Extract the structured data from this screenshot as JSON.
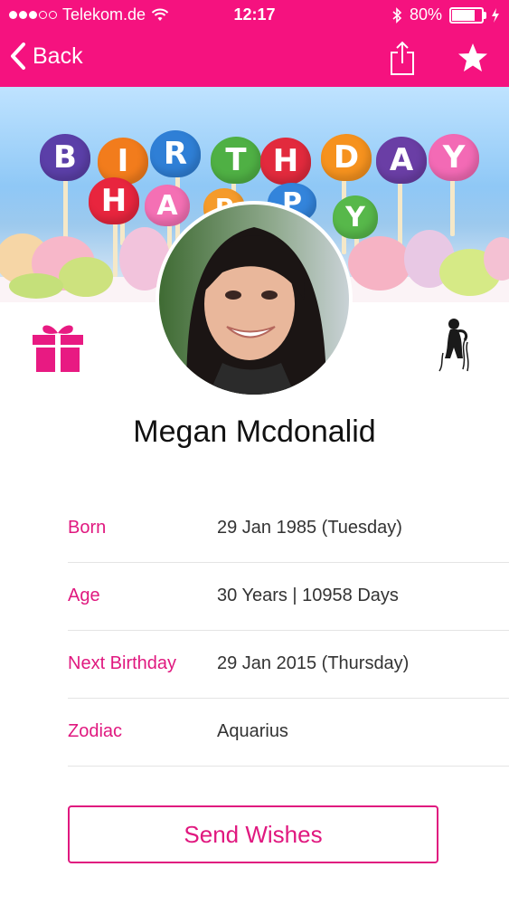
{
  "status_bar": {
    "carrier": "Telekom.de",
    "time": "12:17",
    "battery": "80%",
    "battery_level": 0.8
  },
  "nav": {
    "back_label": "Back"
  },
  "banner": {
    "candle_letters_top": [
      "B",
      "I",
      "R",
      "T",
      "H",
      "D",
      "A",
      "Y"
    ],
    "candle_letters_bottom": [
      "H",
      "A",
      "P",
      "P",
      "Y"
    ]
  },
  "profile": {
    "name": "Megan Mcdonalid"
  },
  "details": [
    {
      "label": "Born",
      "value": "29 Jan 1985 (Tuesday)"
    },
    {
      "label": "Age",
      "value": "30 Years | 10958 Days"
    },
    {
      "label": "Next Birthday",
      "value": "29 Jan 2015 (Thursday)"
    },
    {
      "label": "Zodiac",
      "value": "Aquarius"
    }
  ],
  "actions": {
    "send_wishes_label": "Send Wishes"
  },
  "colors": {
    "accent": "#f5127f",
    "label": "#e0187f"
  },
  "icons": [
    "wifi-icon",
    "bluetooth-icon",
    "battery-icon",
    "chevron-left-icon",
    "share-icon",
    "star-icon",
    "gift-icon",
    "aquarius-icon"
  ]
}
